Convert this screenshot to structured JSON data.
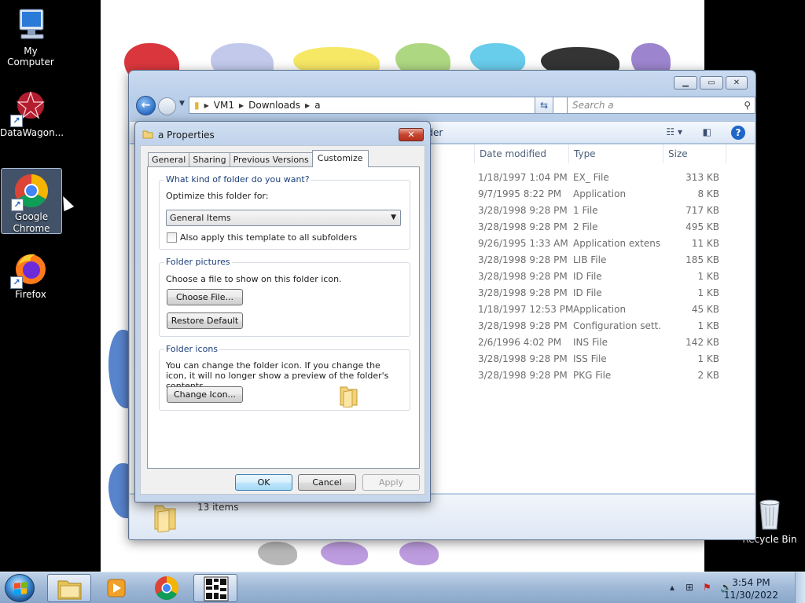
{
  "desktop": {
    "icons": [
      {
        "label": "My Computer",
        "icon": "computer-icon"
      },
      {
        "label": "DataWagon...",
        "icon": "datawagon-icon"
      },
      {
        "label": "Google Chrome",
        "icon": "chrome-icon"
      },
      {
        "label": "Firefox",
        "icon": "firefox-icon"
      },
      {
        "label": "Recycle Bin",
        "icon": "recycle-bin-icon"
      }
    ]
  },
  "explorer": {
    "breadcrumb": [
      "VM1",
      "Downloads",
      "a"
    ],
    "search_placeholder": "Search a",
    "cmd_label_partial": "lder",
    "columns": {
      "date": "Date modified",
      "type": "Type",
      "size": "Size"
    },
    "files": [
      {
        "date": "1/18/1997 1:04 PM",
        "type": "EX_ File",
        "size": "313 KB"
      },
      {
        "date": "9/7/1995 8:22 PM",
        "type": "Application",
        "size": "8 KB"
      },
      {
        "date": "3/28/1998 9:28 PM",
        "type": "1 File",
        "size": "717 KB"
      },
      {
        "date": "3/28/1998 9:28 PM",
        "type": "2 File",
        "size": "495 KB"
      },
      {
        "date": "9/26/1995 1:33 AM",
        "type": "Application extens...",
        "size": "11 KB"
      },
      {
        "date": "3/28/1998 9:28 PM",
        "type": "LIB File",
        "size": "185 KB"
      },
      {
        "date": "3/28/1998 9:28 PM",
        "type": "ID File",
        "size": "1 KB"
      },
      {
        "date": "3/28/1998 9:28 PM",
        "type": "ID File",
        "size": "1 KB"
      },
      {
        "date": "1/18/1997 12:53 PM",
        "type": "Application",
        "size": "45 KB"
      },
      {
        "date": "3/28/1998 9:28 PM",
        "type": "Configuration sett...",
        "size": "1 KB"
      },
      {
        "date": "2/6/1996 4:02 PM",
        "type": "INS File",
        "size": "142 KB"
      },
      {
        "date": "3/28/1998 9:28 PM",
        "type": "ISS File",
        "size": "1 KB"
      },
      {
        "date": "3/28/1998 9:28 PM",
        "type": "PKG File",
        "size": "2 KB"
      }
    ],
    "item_count": "13 items"
  },
  "properties": {
    "title": "a Properties",
    "tabs": [
      "General",
      "Sharing",
      "Previous Versions",
      "Customize"
    ],
    "active_tab": "Customize",
    "group1": {
      "legend": "What kind of folder do you want?",
      "optimize_label": "Optimize this folder for:",
      "optimize_value": "General Items",
      "apply_subfolders_label": "Also apply this template to all subfolders",
      "apply_subfolders_checked": false
    },
    "group2": {
      "legend": "Folder pictures",
      "text": "Choose a file to show on this folder icon.",
      "choose_file": "Choose File...",
      "restore_default": "Restore Default"
    },
    "group3": {
      "legend": "Folder icons",
      "text": "You can change the folder icon. If you change the icon, it will no longer show a preview of the folder's contents.",
      "change_icon": "Change Icon..."
    },
    "buttons": {
      "ok": "OK",
      "cancel": "Cancel",
      "apply": "Apply"
    }
  },
  "taskbar": {
    "items": [
      "windows-explorer-icon",
      "media-player-icon",
      "chrome-icon",
      "qr-app-icon"
    ],
    "active_item": "windows-explorer-icon",
    "time": "3:54 PM",
    "date": "11/30/2022"
  }
}
